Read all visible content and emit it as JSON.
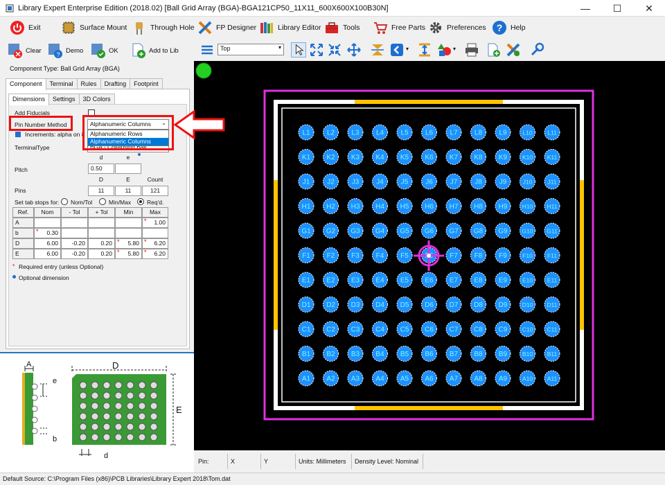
{
  "window": {
    "title": "Library Expert Enterprise Edition (2018.02) [Ball Grid Array (BGA)-BGA121CP50_11X11_600X600X100B30N]",
    "minimize": "—",
    "maximize": "☐",
    "close": "✕"
  },
  "menu": {
    "exit": "Exit",
    "surface_mount": "Surface Mount",
    "through_hole": "Through Hole",
    "fp_designer": "FP Designer",
    "library_editor": "Library Editor",
    "tools": "Tools",
    "free_parts": "Free Parts",
    "preferences": "Preferences",
    "help": "Help"
  },
  "left_toolbar": {
    "clear": "Clear",
    "demo": "Demo",
    "ok": "OK",
    "add_to_lib": "Add to Lib"
  },
  "component_type": "Component Type: Ball Grid Array (BGA)",
  "tabs": [
    "Component",
    "Terminal",
    "Rules",
    "Drafting",
    "Footprint"
  ],
  "subtabs": [
    "Dimensions",
    "Settings",
    "3D Colors"
  ],
  "form": {
    "add_fiducials": "Add Fiducials",
    "pin_number_method": "Pin Number Method",
    "pin_number_value": "Alphanumeric Columns",
    "dropdown_options": [
      "Alphanumeric Rows",
      "Alphanumeric Columns"
    ],
    "increments_label": "Increments: alpha on 8",
    "terminal_type_label": "TerminalType",
    "terminal_type_value": "BGA - Collapsing Ball",
    "pitch_label": "Pitch",
    "pins_label": "Pins",
    "col_d": "d",
    "col_e": "e",
    "pitch_d": "0.50",
    "col_D": "D",
    "col_E": "E",
    "col_count": "Count",
    "pins_D": "11",
    "pins_E": "11",
    "pins_count": "121",
    "tab_stops_label": "Set tab stops for:",
    "radio_nomtol": "Nom/Tol",
    "radio_minmax": "Min/Max",
    "radio_reqd": "Req'd.",
    "table_headers": [
      "Ref.",
      "Nom",
      "- Tol",
      "+ Tol",
      "Min",
      "Max"
    ],
    "rows": [
      {
        "ref": "A",
        "nom": "",
        "mtol": "",
        "ptol": "",
        "min": "",
        "max": "1.00"
      },
      {
        "ref": "b",
        "nom": "0.30",
        "mtol": "",
        "ptol": "",
        "min": "",
        "max": ""
      },
      {
        "ref": "D",
        "nom": "6.00",
        "mtol": "-0.20",
        "ptol": "0.20",
        "min": "5.80",
        "max": "6.20"
      },
      {
        "ref": "E",
        "nom": "6.00",
        "mtol": "-0.20",
        "ptol": "0.20",
        "min": "5.80",
        "max": "6.20"
      }
    ],
    "required_note": "Required entry (unless Optional)",
    "optional_note": "Optional dimension"
  },
  "diagram": {
    "label_A": "A",
    "label_e": "e",
    "label_b": "b",
    "label_D": "D",
    "label_E": "E",
    "label_d": "d"
  },
  "canvas_toolbar": {
    "layer": "Top"
  },
  "status": {
    "pin": "Pin:",
    "x": "X",
    "y": "Y",
    "units": "Units: Millimeters",
    "density": "Density Level: Nominal"
  },
  "default_source": "Default Source:  C:\\Program Files (x86)\\PCB Libraries\\Library Expert 2018\\Tom.dat",
  "bga": {
    "rows": [
      "L",
      "K",
      "J",
      "H",
      "G",
      "F",
      "E",
      "D",
      "C",
      "B",
      "A"
    ],
    "cols": [
      "1",
      "2",
      "3",
      "4",
      "5",
      "6",
      "7",
      "8",
      "9",
      "10",
      "11"
    ],
    "highlighted": "F6"
  },
  "colors": {
    "pad": "#1e90ff",
    "pad_text": "#7ff7ff",
    "courtyard": "#e030e0",
    "body_outline": "#ffffff",
    "assembly_bar": "#ffc400",
    "package_green": "#3a9a35"
  }
}
